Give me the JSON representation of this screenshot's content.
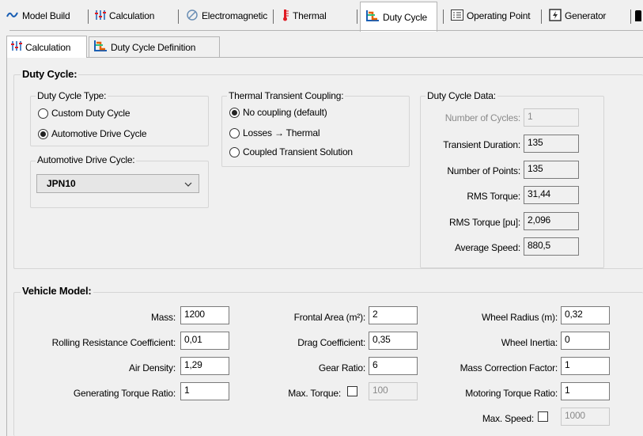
{
  "top_tabs": [
    {
      "label": "Model Build",
      "icon": "model-build-icon"
    },
    {
      "label": "Calculation",
      "icon": "calculation-icon"
    },
    {
      "label": "Electromagnetic",
      "icon": "electromagnetic-icon"
    },
    {
      "label": "Thermal",
      "icon": "thermal-icon"
    },
    {
      "label": "Duty Cycle",
      "icon": "duty-cycle-icon",
      "active": true
    },
    {
      "label": "Operating Point",
      "icon": "operating-point-icon"
    },
    {
      "label": "Generator",
      "icon": "generator-icon"
    }
  ],
  "sub_tabs": [
    {
      "label": "Calculation",
      "icon": "calculation-icon",
      "active": true
    },
    {
      "label": "Duty Cycle Definition",
      "icon": "duty-cycle-icon"
    }
  ],
  "duty_cycle": {
    "title": "Duty Cycle:",
    "type_group": {
      "title": "Duty Cycle Type:",
      "options": [
        "Custom Duty Cycle",
        "Automotive Drive Cycle"
      ],
      "selected": "Automotive Drive Cycle"
    },
    "auto_group": {
      "title": "Automotive Drive Cycle:",
      "selected": "JPN10"
    },
    "coupling_group": {
      "title": "Thermal Transient Coupling:",
      "options": [
        "No coupling (default)",
        "Losses → Thermal",
        "Coupled Transient Solution"
      ],
      "selected": "No coupling (default)"
    },
    "data_group": {
      "title": "Duty Cycle Data:",
      "number_of_cycles_label": "Number of Cycles:",
      "number_of_cycles": "1",
      "transient_duration_label": "Transient Duration:",
      "transient_duration": "135",
      "number_of_points_label": "Number of Points:",
      "number_of_points": "135",
      "rms_torque_label": "RMS Torque:",
      "rms_torque": "31,44",
      "rms_torque_pu_label": "RMS Torque [pu]:",
      "rms_torque_pu": "2,096",
      "average_speed_label": "Average Speed:",
      "average_speed": "880,5"
    }
  },
  "vehicle_model": {
    "title": "Vehicle Model:",
    "mass_label": "Mass:",
    "mass": "1200",
    "rrc_label": "Rolling Resistance Coefficient:",
    "rrc": "0,01",
    "air_density_label": "Air Density:",
    "air_density": "1,29",
    "gen_torque_ratio_label": "Generating Torque Ratio:",
    "gen_torque_ratio": "1",
    "frontal_area_label": "Frontal Area (m²):",
    "frontal_area": "2",
    "drag_coeff_label": "Drag Coefficient:",
    "drag_coeff": "0,35",
    "gear_ratio_label": "Gear Ratio:",
    "gear_ratio": "6",
    "max_torque_label": "Max. Torque:",
    "max_torque": "100",
    "max_torque_checked": false,
    "wheel_radius_label": "Wheel Radius (m):",
    "wheel_radius": "0,32",
    "wheel_inertia_label": "Wheel Inertia:",
    "wheel_inertia": "0",
    "mass_corr_label": "Mass Correction Factor:",
    "mass_corr": "1",
    "motoring_torque_ratio_label": "Motoring Torque Ratio:",
    "motoring_torque_ratio": "1",
    "max_speed_label": "Max. Speed:",
    "max_speed": "1000",
    "max_speed_checked": false
  }
}
